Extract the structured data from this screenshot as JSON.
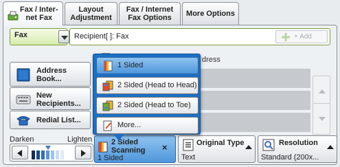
{
  "tabs": [
    {
      "label": "Fax / Inter-\nnet Fax"
    },
    {
      "label": "Layout\nAdjustment"
    },
    {
      "label": "Fax / Internet\nFax Options"
    },
    {
      "label": "More Options"
    }
  ],
  "recipient": {
    "mode": "Fax",
    "field_text": "Recipient[  ]: Fax",
    "add_label": "+ Add"
  },
  "left_buttons": {
    "address_book": "Address\nBook...",
    "new_recipients": "New\nRecipients...",
    "redial_list": "Redial List..."
  },
  "address_list": {
    "header": "dress"
  },
  "popup": {
    "items": [
      {
        "label": "1 Sided",
        "icon": "one-sided-icon"
      },
      {
        "label": "2 Sided (Head to Head)",
        "icon": "head-to-head-icon"
      },
      {
        "label": "2 Sided (Head to Toe)",
        "icon": "head-to-toe-icon"
      },
      {
        "label": "More...",
        "icon": "more-icon"
      }
    ],
    "selected_index": 0
  },
  "density": {
    "darken": "Darken",
    "lighten": "Lighten"
  },
  "features": {
    "scanning": {
      "title": "2 Sided\nScanning",
      "value": "1 Sided",
      "close": "×"
    },
    "original_type": {
      "title": "Original Type",
      "value": "Text"
    },
    "resolution": {
      "title": "Resolution",
      "value": "Standard (200x..."
    }
  },
  "colors": {
    "accent_blue": "#1c70c4",
    "selected_blue": "#4f97dc",
    "recipient_green": "#7a9c3a"
  }
}
